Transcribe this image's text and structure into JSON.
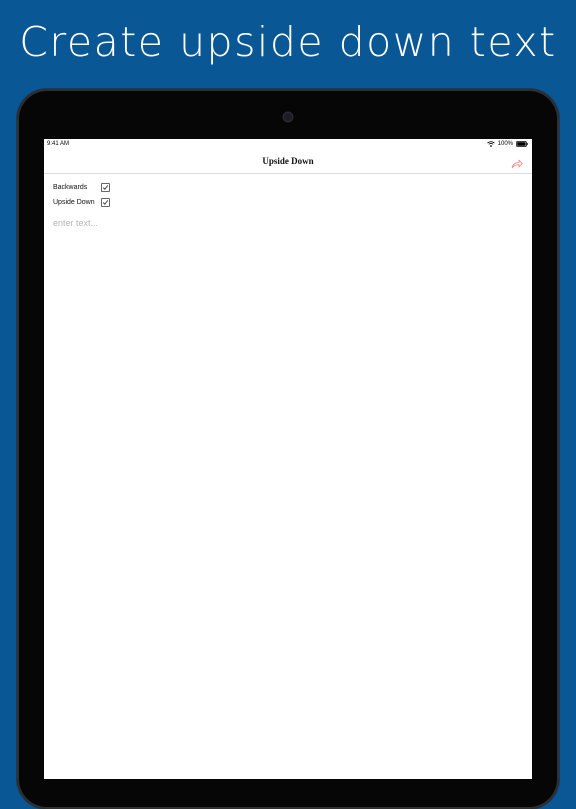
{
  "headline": "Create upside down text",
  "status_bar": {
    "time": "9:41 AM",
    "battery": "100%"
  },
  "nav": {
    "title": "Upside Down",
    "share_icon": "share-arrow-icon"
  },
  "options": [
    {
      "label": "Backwards",
      "checked": true
    },
    {
      "label": "Upside Down",
      "checked": true
    }
  ],
  "input": {
    "placeholder": "enter text...",
    "value": ""
  },
  "colors": {
    "background": "#0a5796",
    "share_icon": "#f08b8b"
  }
}
